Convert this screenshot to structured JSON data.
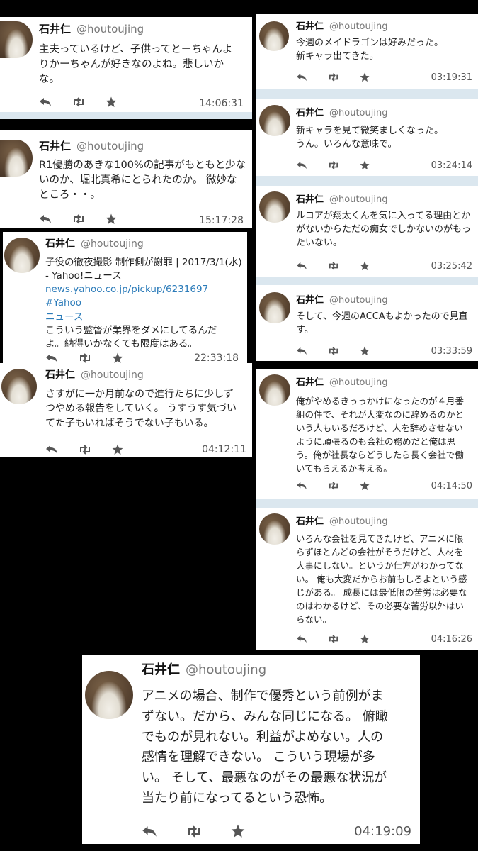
{
  "user": {
    "name": "石井仁",
    "handle": "@houtoujing"
  },
  "icons": {
    "reply": "reply-icon",
    "retweet": "retweet-icon",
    "like": "star-icon"
  },
  "tweets": [
    {
      "lines": [
        "主夫っているけど、子供ってとーちゃんよ",
        "りかーちゃんが好きなのよね。悲しいか",
        "な。"
      ],
      "time": "14:06:31"
    },
    {
      "lines": [
        "R1優勝のあきな100%の記事がもともと少な",
        "いのか、堀北真希にとられたのか。 微妙な",
        "ところ・・。"
      ],
      "time": "15:17:28"
    },
    {
      "lines": [
        "子役の徹夜撮影 制作側が謝罪 | 2017/3/1(水)",
        "- Yahoo!ニュース"
      ],
      "link": [
        "news.yahoo.co.jp/pickup/6231697 #Yahoo",
        "ニュース"
      ],
      "lines2": [
        "こういう監督が業界をダメにしてるんだ",
        "よ。納得いかなくても限度はある。"
      ],
      "time": "22:33:18"
    },
    {
      "lines": [
        "さすがに一か月前なので進行たちに少しず",
        "つやめる報告をしていく。 うすうす気づい",
        "てた子もいればそうでない子もいる。"
      ],
      "time": "04:12:11"
    },
    {
      "lines": [
        "今週のメイドラゴンは好みだった。",
        "新キャラ出てきた。"
      ],
      "time": "03:19:31"
    },
    {
      "lines": [
        "新キャラを見て微笑ましくなった。",
        "うん。いろんな意味で。"
      ],
      "time": "03:24:14"
    },
    {
      "lines": [
        "ルコアが翔太くんを気に入ってる理由とか",
        "がないからただの痴女でしかないのがもっ",
        "たいない。"
      ],
      "time": "03:25:42"
    },
    {
      "lines": [
        "そして、今週のACCAもよかったので見直",
        "す。"
      ],
      "time": "03:33:59"
    },
    {
      "lines": [
        "俺がやめるきっっかけになったのが４月番",
        "組の件で、それが大変なのに辞めるのかと",
        "いう人もいるだろけど、人を辞めさせない",
        "ように頑張るのも会社の務めだと俺は思",
        "う。俺が社長ならどうしたら長く会社で働",
        "いてもらえるか考える。"
      ],
      "time": "04:14:50"
    },
    {
      "lines": [
        "いろんな会社を見てきたけど、アニメに限",
        "らずほとんどの会社がそうだけど、人材を",
        "大事にしない。というか仕方がわかってな",
        "い。 俺も大変だからお前もしろよという感",
        "じがある。 成長には最低限の苦労は必要な",
        "のはわかるけど、その必要な苦労以外はい",
        "らない。"
      ],
      "time": "04:16:26"
    },
    {
      "lines": [
        "アニメの場合、制作で優秀という前例がま",
        "ずない。だから、みんな同じになる。 俯瞰",
        "でものが見れない。利益がよめない。人の",
        "感情を理解できない。 こういう現場が多",
        "い。 そして、最悪なのがその最悪な状況が",
        "当たり前になってるという恐怖。"
      ],
      "time": "04:19:09"
    }
  ]
}
